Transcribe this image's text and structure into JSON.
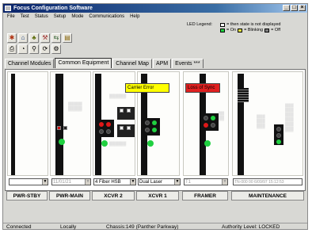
{
  "window": {
    "title": "Focus Configuration Software"
  },
  "menu": [
    "File",
    "Test",
    "Status",
    "Setup",
    "Mode",
    "Communications",
    "Help"
  ],
  "legend": {
    "title": "LED Legend:",
    "not_displayed": "= then state is not displayed",
    "on": "= On",
    "blinking": "= Blinking",
    "off": "= Off"
  },
  "tabs": [
    "Channel Modules",
    "Common Equipment",
    "Channel Map",
    "APM",
    "Events ***"
  ],
  "callouts": {
    "xcvr1": "Carrier Error",
    "framer": "Loss of Sync"
  },
  "selects": {
    "pwr_stby": "",
    "pwr_main": "11/01/21",
    "xcvr2": "4 Fiber HSB",
    "xcvr1": "Dual Laser",
    "framer": "T1",
    "maintenance": "TN-000 00     6/09/97   15:12:53"
  },
  "module_labels": [
    "PWR-STBY",
    "PWR-MAIN",
    "XCVR 2",
    "XCVR 1",
    "FRAMER",
    "MAINTENANCE"
  ],
  "status": {
    "connection": "Connected",
    "mode": "Locally",
    "chassis": "Chassis:149 (Panther Parkway)",
    "authority": "Authority Level: LOCKED"
  },
  "colors": {
    "title_bar": "#0a246a",
    "callout_yellow": "#ffff00",
    "callout_red": "#e02020",
    "led_green": "#20d040",
    "led_red": "#e01818"
  }
}
